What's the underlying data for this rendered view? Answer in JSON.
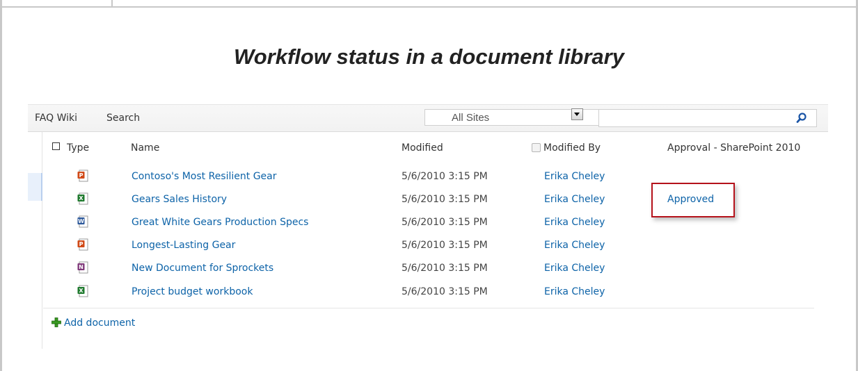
{
  "page_title": "Workflow status in a document library",
  "nav": {
    "faq_wiki": "FAQ Wiki",
    "search": "Search"
  },
  "search": {
    "scope_value": "All Sites",
    "query_value": ""
  },
  "columns": {
    "type": "Type",
    "name": "Name",
    "modified": "Modified",
    "modified_by": "Modified By",
    "workflow": "Approval - SharePoint 2010"
  },
  "rows": [
    {
      "icon": "powerpoint-icon",
      "name": "Contoso's Most Resilient Gear",
      "modified": "5/6/2010 3:15 PM",
      "modified_by": "Erika Cheley",
      "workflow_status": ""
    },
    {
      "icon": "excel-icon",
      "name": "Gears Sales History",
      "modified": "5/6/2010 3:15 PM",
      "modified_by": "Erika Cheley",
      "workflow_status": "Approved"
    },
    {
      "icon": "word-icon",
      "name": "Great White Gears Production Specs",
      "modified": "5/6/2010 3:15 PM",
      "modified_by": "Erika Cheley",
      "workflow_status": ""
    },
    {
      "icon": "powerpoint-icon",
      "name": "Longest-Lasting Gear",
      "modified": "5/6/2010 3:15 PM",
      "modified_by": "Erika Cheley",
      "workflow_status": ""
    },
    {
      "icon": "onenote-icon",
      "name": "New Document for Sprockets",
      "modified": "5/6/2010 3:15 PM",
      "modified_by": "Erika Cheley",
      "workflow_status": ""
    },
    {
      "icon": "excel-icon",
      "name": "Project budget workbook",
      "modified": "5/6/2010 3:15 PM",
      "modified_by": "Erika Cheley",
      "workflow_status": ""
    }
  ],
  "add_document": "Add document",
  "colors": {
    "link": "#0d63a8",
    "callout": "#b5121b",
    "powerpoint": "#d04a18",
    "excel": "#1f7a2e",
    "word": "#2b579a",
    "onenote": "#80397b",
    "add": "#3a9b22"
  }
}
